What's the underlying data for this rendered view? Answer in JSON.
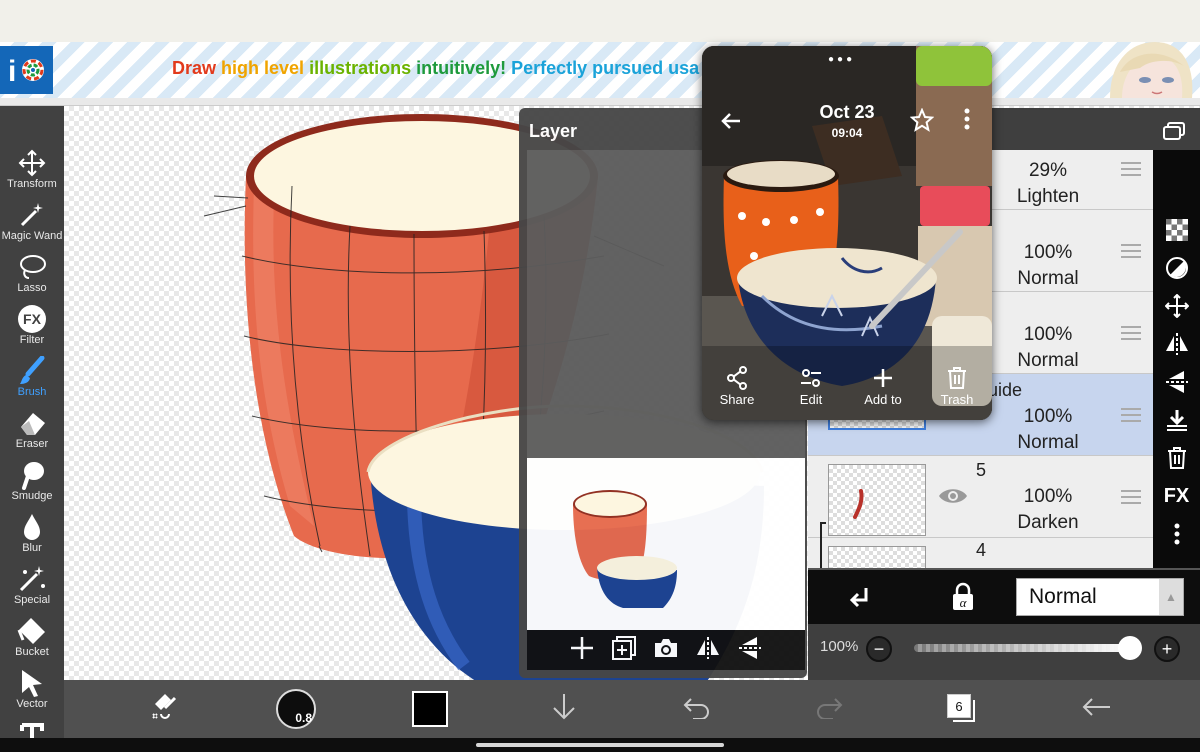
{
  "banner": {
    "segments": [
      {
        "text": "Draw ",
        "color": "#e23a1c"
      },
      {
        "text": "high level ",
        "color": "#f0a400"
      },
      {
        "text": "illustrations ",
        "color": "#6bb300"
      },
      {
        "text": "intuitively! ",
        "color": "#1e9a3c"
      },
      {
        "text": "Perfectly pursued usa",
        "color": "#1ba3d9"
      }
    ],
    "logo_icon": "ibis-paint-logo",
    "avatar_icon": "anime-character-avatar"
  },
  "toolbar": {
    "tools": [
      {
        "label": "Transform",
        "icon": "transform-icon",
        "active": false
      },
      {
        "label": "Magic Wand",
        "icon": "magic-wand-icon",
        "active": false
      },
      {
        "label": "Lasso",
        "icon": "lasso-icon",
        "active": false
      },
      {
        "label": "Filter",
        "icon": "filter-icon",
        "active": false
      },
      {
        "label": "Brush",
        "icon": "brush-icon",
        "active": true
      },
      {
        "label": "Eraser",
        "icon": "eraser-icon",
        "active": false
      },
      {
        "label": "Smudge",
        "icon": "smudge-icon",
        "active": false
      },
      {
        "label": "Blur",
        "icon": "blur-icon",
        "active": false
      },
      {
        "label": "Special",
        "icon": "special-icon",
        "active": false
      },
      {
        "label": "Bucket",
        "icon": "bucket-icon",
        "active": false
      },
      {
        "label": "Vector",
        "icon": "vector-icon",
        "active": false
      }
    ]
  },
  "layer_panel": {
    "title": "Layer",
    "fx_label": "FX",
    "layers": [
      {
        "number": "",
        "opacity": "29%",
        "mode": "Lighten",
        "selected": false
      },
      {
        "number": "",
        "opacity": "100%",
        "mode": "Normal",
        "selected": false
      },
      {
        "number": "",
        "opacity": "100%",
        "mode": "Normal",
        "selected": false
      },
      {
        "number": "uide",
        "opacity": "100%",
        "mode": "Normal",
        "selected": true
      },
      {
        "number": "5",
        "opacity": "100%",
        "mode": "Darken",
        "selected": false
      },
      {
        "number": "4",
        "opacity": "",
        "mode": "",
        "selected": false
      }
    ],
    "blend_mode": "Normal",
    "opacity_label": "100%",
    "opacity_value": 100
  },
  "gallery": {
    "date": "Oct 23",
    "time": "09:04",
    "actions": [
      {
        "label": "Share",
        "icon": "share-icon"
      },
      {
        "label": "Edit",
        "icon": "edit-sliders-icon"
      },
      {
        "label": "Add to",
        "icon": "plus-icon"
      },
      {
        "label": "Trash",
        "icon": "trash-icon"
      }
    ]
  },
  "bottom_bar": {
    "brush_size": "0.8",
    "layer_count": "6",
    "primary_color": "#000000"
  },
  "colors": {
    "toolbar_bg": "#414141",
    "accent_blue": "#3fa0ff",
    "selected_layer": "#c7d5ee",
    "cup_orange": "#e76a4d",
    "bowl_blue": "#1d4391",
    "cream": "#fdf6e0"
  }
}
